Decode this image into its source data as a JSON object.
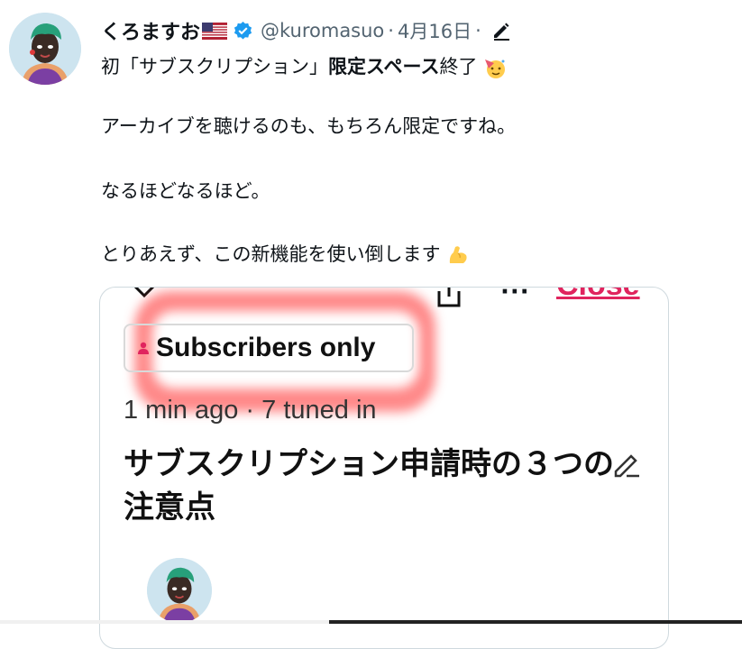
{
  "tweet": {
    "display_name": "くろますお",
    "handle": "@kuromasuo",
    "sep1": "·",
    "date": "4月16日",
    "sep2": "·",
    "line1_pre": "初「サブスクリプション」",
    "line1_bold": "限定スペース",
    "line1_post": "終了",
    "line2": "アーカイブを聴けるのも、もちろん限定ですね。",
    "line3": "なるほどなるほど。",
    "line4": "とりあえず、この新機能を使い倒します"
  },
  "card": {
    "close_label": "Close",
    "more_label": "···",
    "badge_label": "Subscribers only",
    "meta": "1 min ago · 7 tuned in",
    "title": "サブスクリプション申請時の３つの注意点"
  },
  "colors": {
    "verified": "#1d9bf0",
    "close": "#e0245e",
    "highlight": "#ff2828",
    "secondary_text": "#536471"
  },
  "icons": [
    "us-flag-icon",
    "verified-badge-icon",
    "edit-pencil-icon",
    "party-face-emoji-icon",
    "flexed-biceps-emoji-icon",
    "chevron-down-icon",
    "share-icon",
    "more-icon",
    "subscriber-icon",
    "edit-title-icon"
  ]
}
